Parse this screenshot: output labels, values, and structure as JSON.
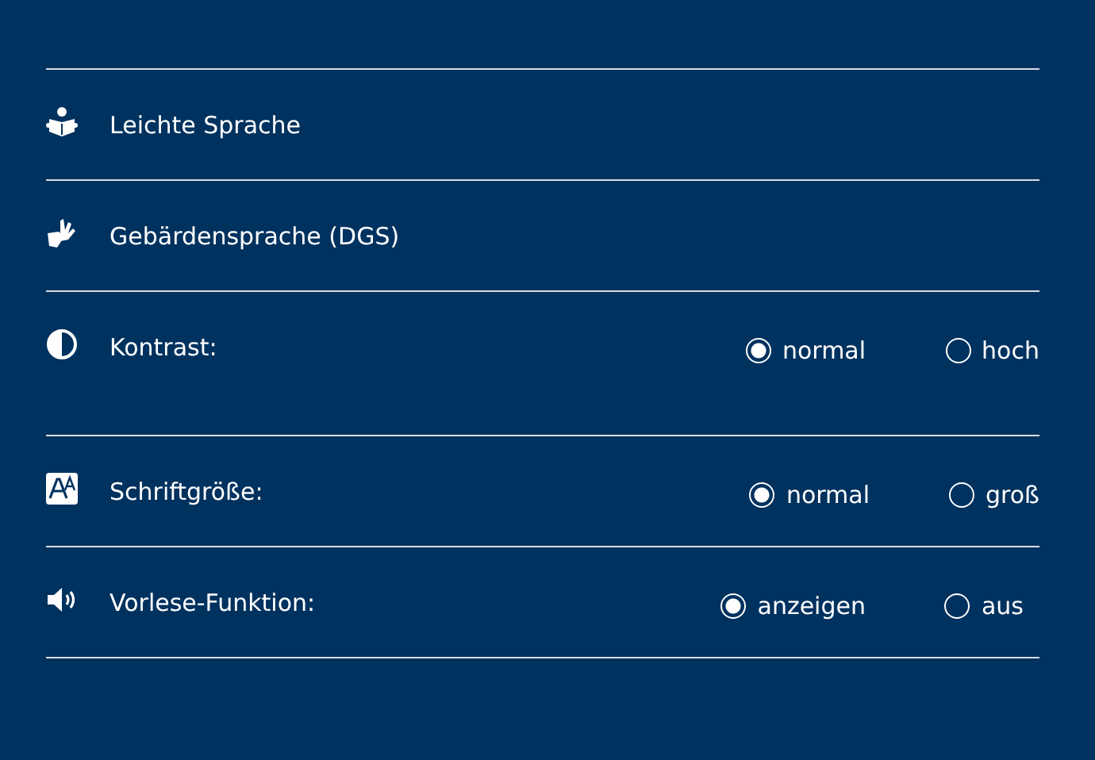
{
  "rows": [
    {
      "kind": "link",
      "label": "Leichte Sprache"
    },
    {
      "kind": "link",
      "label": "Gebärdensprache (DGS)"
    },
    {
      "kind": "options",
      "label": "Kontrast:",
      "options": [
        {
          "label": "normal",
          "selected": true
        },
        {
          "label": "hoch",
          "selected": false
        }
      ]
    },
    {
      "kind": "options",
      "label": "Schriftgröße:",
      "options": [
        {
          "label": "normal",
          "selected": true
        },
        {
          "label": "groß",
          "selected": false
        }
      ]
    },
    {
      "kind": "options",
      "label": "Vorlese-Funktion:",
      "options": [
        {
          "label": "anzeigen",
          "selected": true
        },
        {
          "label": "aus",
          "selected": false
        }
      ]
    }
  ]
}
